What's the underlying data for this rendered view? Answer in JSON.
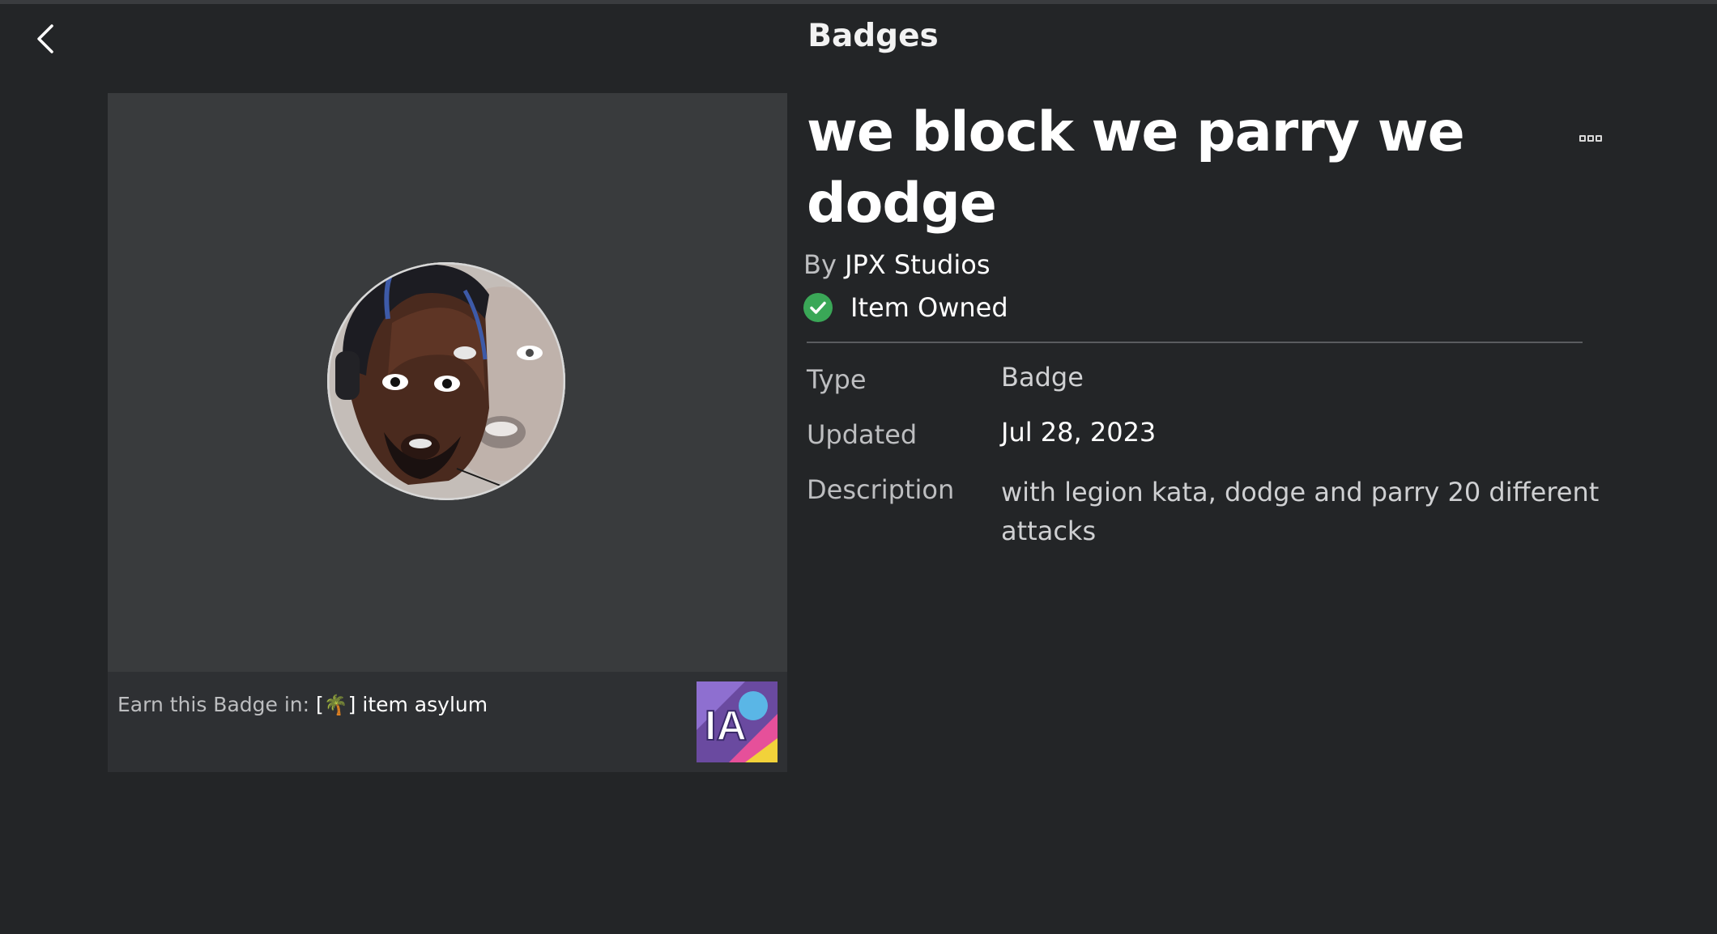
{
  "header": {
    "title": "Badges"
  },
  "badge": {
    "name": "we block we parry we dodge",
    "by_prefix": "By",
    "creator": "JPX Studios",
    "owned_label": "Item Owned",
    "more_icon": "more-options-icon"
  },
  "earn": {
    "prefix": "Earn this Badge in: ",
    "game_open": "[",
    "game_emoji": "🌴",
    "game_close": "] item asylum",
    "thumbnail_text": "IA"
  },
  "details": {
    "type_label": "Type",
    "type_value": "Badge",
    "updated_label": "Updated",
    "updated_value": "Jul 28, 2023",
    "description_label": "Description",
    "description_value": "with legion kata, dodge and parry 20 different attacks"
  },
  "colors": {
    "background": "#232527",
    "card": "#393b3d",
    "owned_check": "#3aa757"
  }
}
